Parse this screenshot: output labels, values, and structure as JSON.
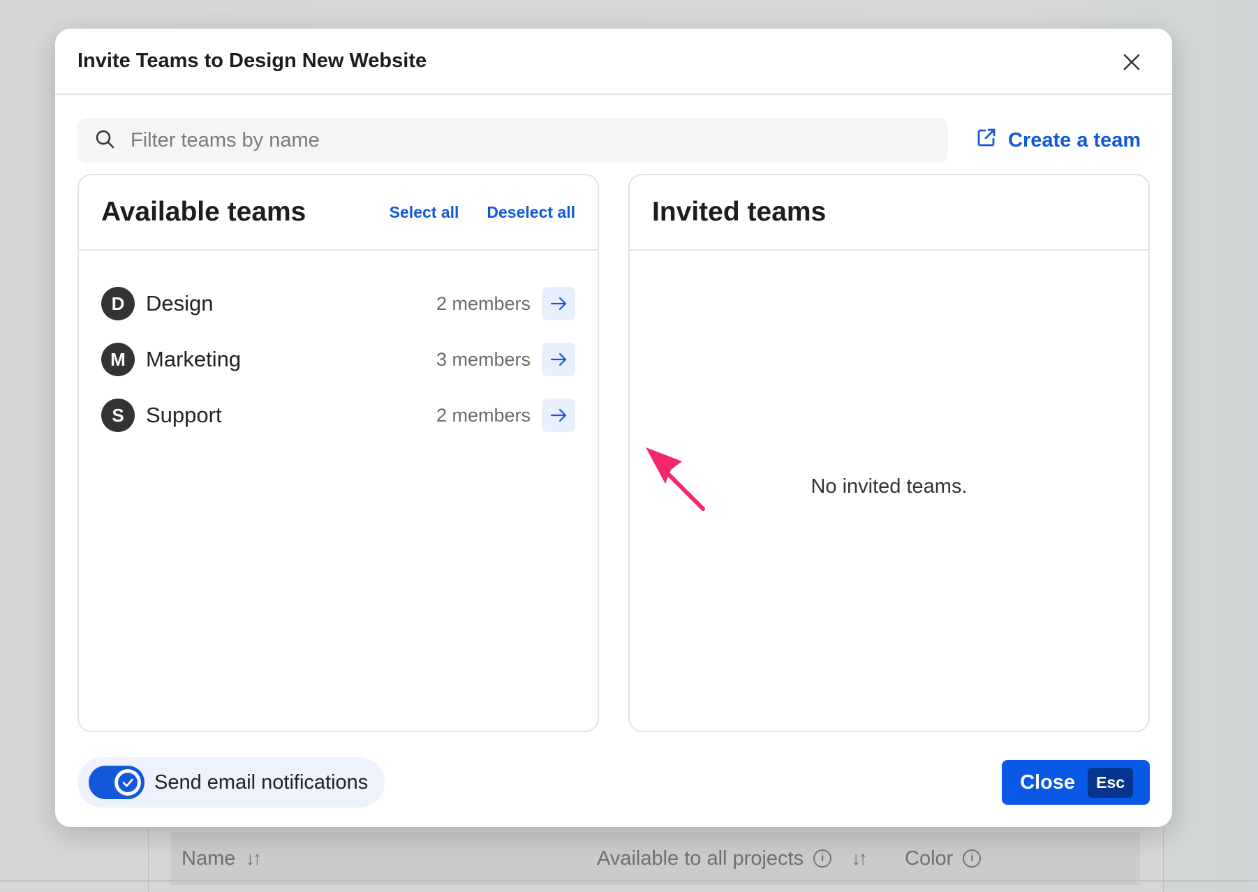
{
  "modal": {
    "title": "Invite Teams to Design New Website",
    "close_icon": "close-icon"
  },
  "search": {
    "placeholder": "Filter teams by name",
    "value": ""
  },
  "create_team": {
    "label": "Create a team",
    "icon": "external-link-icon"
  },
  "available": {
    "title": "Available teams",
    "select_all": "Select all",
    "deselect_all": "Deselect all",
    "teams": [
      {
        "initial": "D",
        "name": "Design",
        "members": "2 members"
      },
      {
        "initial": "M",
        "name": "Marketing",
        "members": "3 members"
      },
      {
        "initial": "S",
        "name": "Support",
        "members": "2 members"
      }
    ]
  },
  "invited": {
    "title": "Invited teams",
    "empty": "No invited teams."
  },
  "footer": {
    "notify_label": "Send email notifications",
    "notify_on": true,
    "close_label": "Close",
    "close_shortcut": "Esc"
  },
  "background_table": {
    "col_name": "Name",
    "col_available": "Available to all projects",
    "col_color": "Color"
  },
  "colors": {
    "accent": "#1358d8",
    "primary_button": "#0a58e6",
    "annotation": "#f4266e"
  }
}
